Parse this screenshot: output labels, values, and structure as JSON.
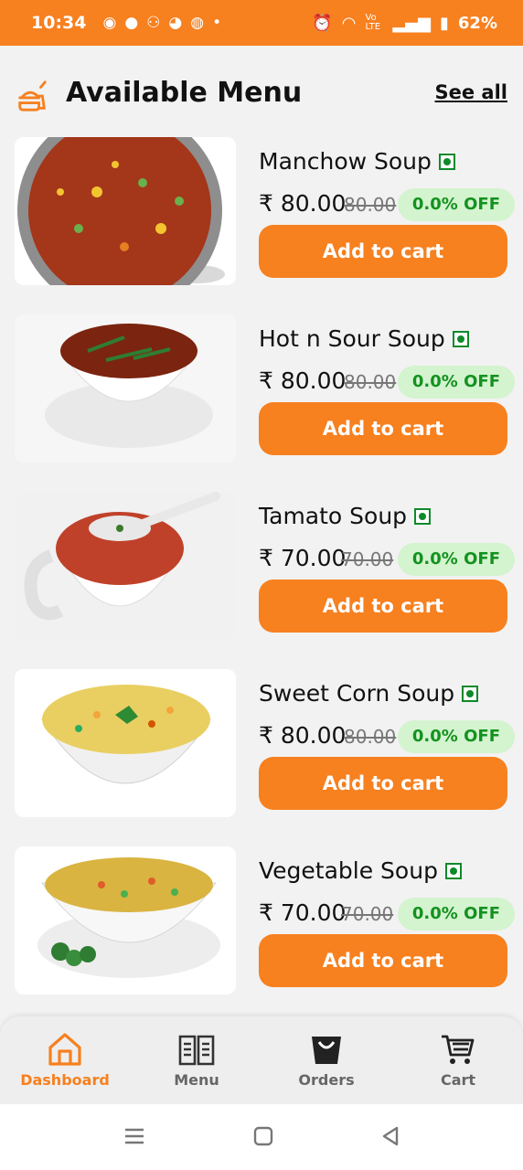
{
  "status": {
    "time": "10:34",
    "network": "Vo LTE",
    "battery": "62%"
  },
  "header": {
    "title": "Available Menu",
    "see_all": "See all"
  },
  "items": [
    {
      "name": "Manchow Soup",
      "price": "₹ 80.00",
      "mrp": "80.00",
      "off": "0.0% OFF",
      "cta": "Add to cart"
    },
    {
      "name": "Hot n Sour Soup",
      "price": "₹ 80.00",
      "mrp": "80.00",
      "off": "0.0% OFF",
      "cta": "Add to cart"
    },
    {
      "name": "Tamato Soup",
      "price": "₹ 70.00",
      "mrp": "70.00",
      "off": "0.0% OFF",
      "cta": "Add to cart"
    },
    {
      "name": "Sweet Corn Soup",
      "price": "₹ 80.00",
      "mrp": "80.00",
      "off": "0.0% OFF",
      "cta": "Add to cart"
    },
    {
      "name": "Vegetable Soup",
      "price": "₹ 70.00",
      "mrp": "70.00",
      "off": "0.0% OFF",
      "cta": "Add to cart"
    }
  ],
  "nav": {
    "dashboard": "Dashboard",
    "menu": "Menu",
    "orders": "Orders",
    "cart": "Cart",
    "active": "dashboard"
  },
  "colors": {
    "accent": "#f7801f",
    "veg_green": "#0d8a2a",
    "discount_bg": "#d4f3cf",
    "discount_text": "#13921f"
  }
}
